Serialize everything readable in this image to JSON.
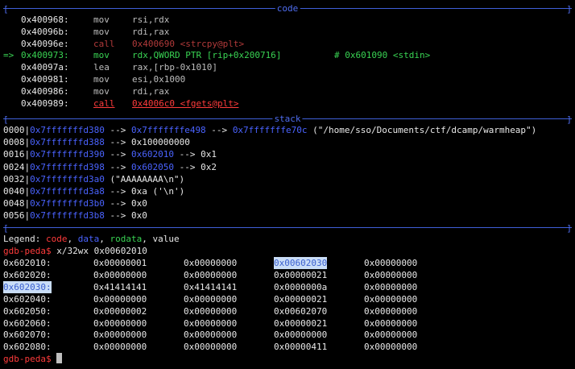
{
  "code_header": "code",
  "stack_header": "stack",
  "code": [
    {
      "marker": "",
      "addr": "0x400968:",
      "mnem": "mov",
      "ops": "rsi,rdx",
      "comment": "",
      "style": "normal"
    },
    {
      "marker": "",
      "addr": "0x40096b:",
      "mnem": "mov",
      "ops": "rdi,rax",
      "comment": "",
      "style": "normal"
    },
    {
      "marker": "",
      "addr": "0x40096e:",
      "mnem": "call",
      "ops": "0x400690 <strcpy@plt>",
      "comment": "",
      "style": "dimcall"
    },
    {
      "marker": "=>",
      "addr": "0x400973:",
      "mnem": "mov",
      "ops": "rdx,QWORD PTR [rip+0x200716]",
      "comment": "# 0x601090 <stdin>",
      "style": "current"
    },
    {
      "marker": "",
      "addr": "0x40097a:",
      "mnem": "lea",
      "ops": "rax,[rbp-0x1010]",
      "comment": "",
      "style": "normal"
    },
    {
      "marker": "",
      "addr": "0x400981:",
      "mnem": "mov",
      "ops": "esi,0x1000",
      "comment": "",
      "style": "normal"
    },
    {
      "marker": "",
      "addr": "0x400986:",
      "mnem": "mov",
      "ops": "rdi,rax",
      "comment": "",
      "style": "normal"
    },
    {
      "marker": "",
      "addr": "0x400989:",
      "mnem": "call",
      "ops": "0x4006c0 <fgets@plt>",
      "comment": "",
      "style": "nextcall"
    }
  ],
  "stack": [
    {
      "off": "0000|",
      "addr": "0x7fffffffd380",
      "chain": [
        {
          "t": " --> ",
          "c": "arrow"
        },
        {
          "t": "0x7fffffffe498",
          "c": "blue"
        },
        {
          "t": " --> ",
          "c": "arrow"
        },
        {
          "t": "0x7fffffffe70c",
          "c": "blue"
        },
        {
          "t": " (\"/home/sso/Documents/ctf/dcamp/warmheap\")",
          "c": "white"
        }
      ]
    },
    {
      "off": "0008|",
      "addr": "0x7fffffffd388",
      "chain": [
        {
          "t": " --> ",
          "c": "arrow"
        },
        {
          "t": "0x100000000",
          "c": "white"
        }
      ]
    },
    {
      "off": "0016|",
      "addr": "0x7fffffffd390",
      "chain": [
        {
          "t": " --> ",
          "c": "arrow"
        },
        {
          "t": "0x602010",
          "c": "blue"
        },
        {
          "t": " --> ",
          "c": "arrow"
        },
        {
          "t": "0x1",
          "c": "white"
        }
      ]
    },
    {
      "off": "0024|",
      "addr": "0x7fffffffd398",
      "chain": [
        {
          "t": " --> ",
          "c": "arrow"
        },
        {
          "t": "0x602050",
          "c": "blue"
        },
        {
          "t": " --> ",
          "c": "arrow"
        },
        {
          "t": "0x2",
          "c": "white"
        }
      ]
    },
    {
      "off": "0032|",
      "addr": "0x7fffffffd3a0",
      "chain": [
        {
          "t": " (\"AAAAAAAA\\n\")",
          "c": "white"
        }
      ]
    },
    {
      "off": "0040|",
      "addr": "0x7fffffffd3a8",
      "chain": [
        {
          "t": " --> ",
          "c": "arrow"
        },
        {
          "t": "0xa ('\\n')",
          "c": "white"
        }
      ]
    },
    {
      "off": "0048|",
      "addr": "0x7fffffffd3b0",
      "chain": [
        {
          "t": " --> ",
          "c": "arrow"
        },
        {
          "t": "0x0",
          "c": "white"
        }
      ]
    },
    {
      "off": "0056|",
      "addr": "0x7fffffffd3b8",
      "chain": [
        {
          "t": " --> ",
          "c": "arrow"
        },
        {
          "t": "0x0",
          "c": "white"
        }
      ]
    }
  ],
  "legend": {
    "prefix": "Legend: ",
    "code": "code",
    "data": "data",
    "rodata": "rodata",
    "value": "value"
  },
  "prompt": "gdb-peda$",
  "command": " x/32wx 0x00602010",
  "memory": [
    {
      "addr": "0x602010:",
      "words": [
        "0x00000001",
        "0x00000000",
        "0x00602030",
        "0x00000000"
      ],
      "hl_addr": false,
      "hl_word": 2
    },
    {
      "addr": "0x602020:",
      "words": [
        "0x00000000",
        "0x00000000",
        "0x00000021",
        "0x00000000"
      ],
      "hl_addr": false,
      "hl_word": -1
    },
    {
      "addr": "0x602030:",
      "words": [
        "0x41414141",
        "0x41414141",
        "0x0000000a",
        "0x00000000"
      ],
      "hl_addr": true,
      "hl_word": -1
    },
    {
      "addr": "0x602040:",
      "words": [
        "0x00000000",
        "0x00000000",
        "0x00000021",
        "0x00000000"
      ],
      "hl_addr": false,
      "hl_word": -1
    },
    {
      "addr": "0x602050:",
      "words": [
        "0x00000002",
        "0x00000000",
        "0x00602070",
        "0x00000000"
      ],
      "hl_addr": false,
      "hl_word": -1
    },
    {
      "addr": "0x602060:",
      "words": [
        "0x00000000",
        "0x00000000",
        "0x00000021",
        "0x00000000"
      ],
      "hl_addr": false,
      "hl_word": -1
    },
    {
      "addr": "0x602070:",
      "words": [
        "0x00000000",
        "0x00000000",
        "0x00000000",
        "0x00000000"
      ],
      "hl_addr": false,
      "hl_word": -1
    },
    {
      "addr": "0x602080:",
      "words": [
        "0x00000000",
        "0x00000000",
        "0x00000411",
        "0x00000000"
      ],
      "hl_addr": false,
      "hl_word": -1
    }
  ],
  "prompt2": "gdb-peda$",
  "colors": {
    "blue": "#4a63ff",
    "green": "#39d353",
    "red": "#ff3b3b",
    "highlight": "#c9ddf7"
  }
}
